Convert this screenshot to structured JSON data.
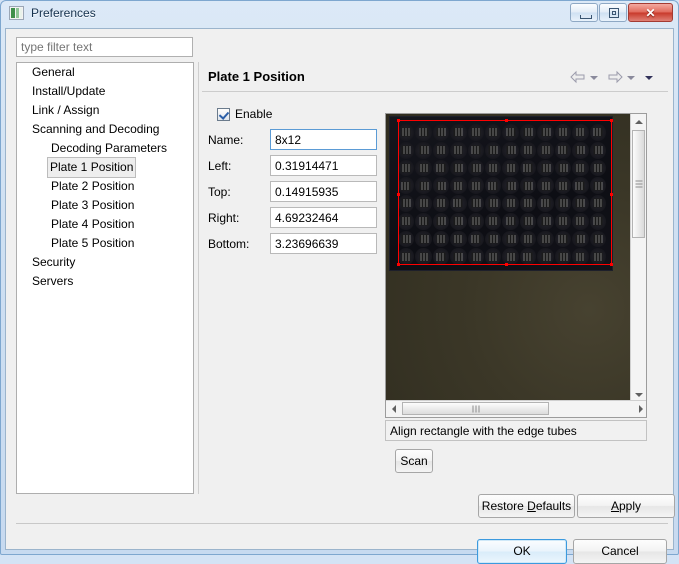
{
  "window": {
    "title": "Preferences",
    "icon": "preferences-icon",
    "controls": {
      "minimize": "minimize-button",
      "restore": "restore-button",
      "close_label": "✕"
    }
  },
  "filter": {
    "placeholder": "type filter text",
    "value": ""
  },
  "tree": {
    "items": [
      {
        "label": "General",
        "level": 1,
        "selected": false
      },
      {
        "label": "Install/Update",
        "level": 1,
        "selected": false
      },
      {
        "label": "Link / Assign",
        "level": 1,
        "selected": false
      },
      {
        "label": "Scanning and Decoding",
        "level": 1,
        "selected": false
      },
      {
        "label": "Decoding Parameters",
        "level": 2,
        "selected": false
      },
      {
        "label": "Plate 1 Position",
        "level": 2,
        "selected": true
      },
      {
        "label": "Plate 2 Position",
        "level": 2,
        "selected": false
      },
      {
        "label": "Plate 3 Position",
        "level": 2,
        "selected": false
      },
      {
        "label": "Plate 4 Position",
        "level": 2,
        "selected": false
      },
      {
        "label": "Plate 5 Position",
        "level": 2,
        "selected": false
      },
      {
        "label": "Security",
        "level": 1,
        "selected": false
      },
      {
        "label": "Servers",
        "level": 1,
        "selected": false
      }
    ]
  },
  "page": {
    "title": "Plate 1 Position",
    "nav": {
      "back": "back-arrow",
      "back_menu": "back-dropdown",
      "forward": "forward-arrow",
      "forward_menu": "forward-dropdown",
      "more": "more-dropdown"
    }
  },
  "form": {
    "enable": {
      "label": "Enable",
      "checked": true
    },
    "fields": [
      {
        "label": "Name:",
        "value": "8x12",
        "focused": true
      },
      {
        "label": "Left:",
        "value": "0.31914471",
        "focused": false
      },
      {
        "label": "Top:",
        "value": "0.14915935",
        "focused": false
      },
      {
        "label": "Right:",
        "value": "4.69232464",
        "focused": false
      },
      {
        "label": "Bottom:",
        "value": "3.23696639",
        "focused": false
      }
    ]
  },
  "viewer": {
    "plate": {
      "rows": 8,
      "columns": 12
    },
    "selection_color": "#ff0000",
    "status_text": "Align rectangle with the edge tubes",
    "scrollbar_h": "horizontal-scrollbar",
    "scrollbar_v": "vertical-scrollbar"
  },
  "buttons": {
    "scan": "Scan",
    "restore_defaults": {
      "before": "Restore ",
      "accel": "D",
      "after": "efaults"
    },
    "apply": {
      "before": "",
      "accel": "A",
      "after": "pply"
    },
    "ok": "OK",
    "cancel": "Cancel"
  }
}
